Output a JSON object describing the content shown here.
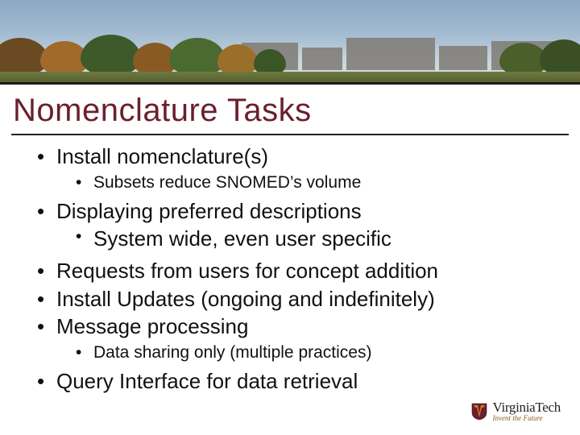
{
  "title": "Nomenclature Tasks",
  "bullets": {
    "b1": "Install nomenclature(s)",
    "b1a": "Subsets reduce SNOMED’s volume",
    "b2": "Displaying preferred descriptions",
    "b2a": "System wide, even user specific",
    "b3": "Requests from users for concept addition",
    "b4": "Install Updates (ongoing and indefinitely)",
    "b5": "Message processing",
    "b5a": "Data sharing only (multiple practices)",
    "b6": "Query Interface for data retrieval"
  },
  "logo": {
    "name": "VirginiaTech",
    "tagline": "Invent the Future"
  },
  "colors": {
    "maroon": "#6b1f2e",
    "orange": "#cf7f1a"
  }
}
